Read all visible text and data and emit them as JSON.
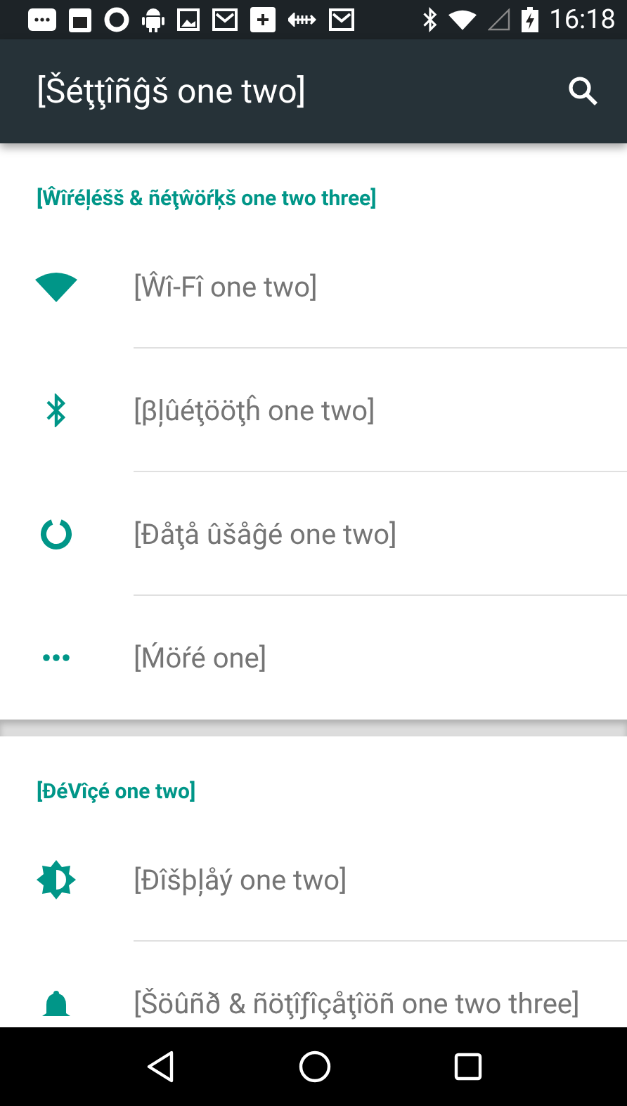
{
  "status_bar": {
    "time": "16:18"
  },
  "app_bar": {
    "title": "[Šéţţîñĝš one two]"
  },
  "sections": [
    {
      "header": "[Ŵîŕéļéšš & ñéţŵöŕķš one two three]",
      "items": [
        {
          "kind": "wifi",
          "label": "[Ŵî-Fî one two]"
        },
        {
          "kind": "bluetooth",
          "label": "[βļûéţööţĥ one two]"
        },
        {
          "kind": "data",
          "label": "[Đåţå ûšåĝé one two]"
        },
        {
          "kind": "more",
          "label": "[Ḿöŕé one]"
        }
      ]
    },
    {
      "header": "[ĐéVîçé one two]",
      "items": [
        {
          "kind": "display",
          "label": "[Đîšþļåý one two]"
        },
        {
          "kind": "sound",
          "label": "[Šöûñð & ñöţîƒîçåţîöñ one two three]"
        }
      ]
    }
  ]
}
